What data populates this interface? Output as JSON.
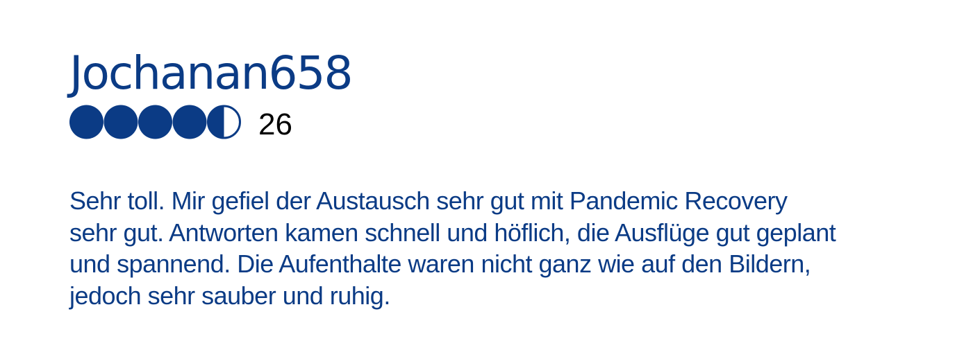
{
  "review": {
    "username": "Jochanan658",
    "rating": 4.5,
    "rating_max": 5,
    "review_count": "26",
    "text": "Sehr toll. Mir gefiel der Austausch sehr gut mit Pandemic Recovery sehr gut. Antworten kamen schnell und höflich, die Ausflüge gut geplant und spannend. Die Aufenthalte waren nicht ganz wie auf den Bildern, jedoch sehr sauber und ruhig."
  },
  "colors": {
    "accent": "#0b3b85",
    "count_text": "#000000",
    "background": "#ffffff"
  },
  "icons": {
    "rating": "bubble-rating-icon"
  }
}
